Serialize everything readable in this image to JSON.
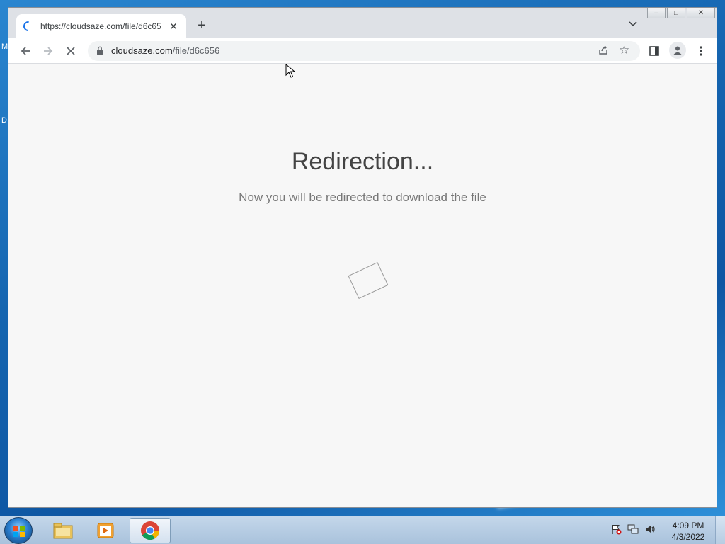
{
  "desktop": {
    "side_labels": [
      "M",
      "D"
    ]
  },
  "window": {
    "caption": {
      "minimize": "–",
      "maximize": "□",
      "close": "✕"
    }
  },
  "tab": {
    "title": "https://cloudsaze.com/file/d6c65",
    "close_glyph": "✕"
  },
  "newtab_glyph": "+",
  "toolbar": {
    "url_host": "cloudsaze.com",
    "url_path": "/file/d6c656",
    "back_icon": "arrow-left-icon",
    "forward_icon": "arrow-right-icon",
    "stop_icon": "stop-loading-icon"
  },
  "page": {
    "heading": "Redirection...",
    "subtext": "Now you will be redirected to download the file"
  },
  "taskbar": {
    "time": "4:09 PM",
    "date": "4/3/2022",
    "apps": [
      "file-explorer-icon",
      "media-player-icon",
      "chrome-icon"
    ]
  },
  "colors": {
    "accent": "#1a73e8",
    "page_bg": "#f7f7f7",
    "heading": "#444444",
    "subtext": "#777777"
  }
}
